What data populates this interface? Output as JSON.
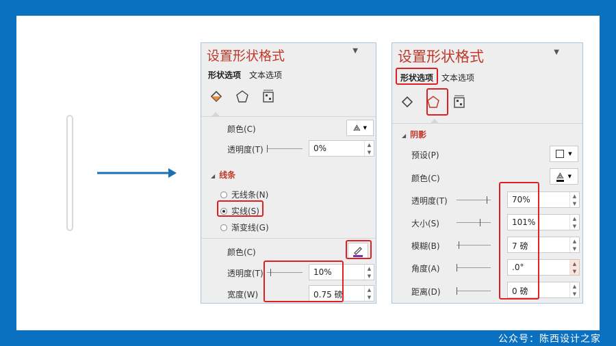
{
  "footer": "公众号：陈西设计之家",
  "left_pane": {
    "title": "设置形状格式",
    "tabs": [
      "形状选项",
      "文本选项"
    ],
    "fill_color_label": "颜色(C)",
    "fill_transparency_label": "透明度(T)",
    "fill_transparency_value": "0%",
    "line_section": "线条",
    "radio_none": "无线条(N)",
    "radio_solid": "实线(S)",
    "radio_gradient": "渐变线(G)",
    "line_color_label": "颜色(C)",
    "line_transparency_label": "透明度(T)",
    "line_transparency_value": "10%",
    "line_width_label": "宽度(W)",
    "line_width_value": "0.75 磅"
  },
  "right_pane": {
    "title": "设置形状格式",
    "tabs": [
      "形状选项",
      "文本选项"
    ],
    "shadow_section": "阴影",
    "preset_label": "预设(P)",
    "color_label": "颜色(C)",
    "transparency_label": "透明度(T)",
    "transparency_value": "70%",
    "size_label": "大小(S)",
    "size_value": "101%",
    "blur_label": "模糊(B)",
    "blur_value": "7 磅",
    "angle_label": "角度(A)",
    "angle_value": ".0°",
    "distance_label": "距离(D)",
    "distance_value": "0 磅"
  },
  "colors": {
    "accent": "#c0392b",
    "highlight": "#e02020",
    "frame": "#0a71c0",
    "arrow": "#1a6fb5"
  }
}
